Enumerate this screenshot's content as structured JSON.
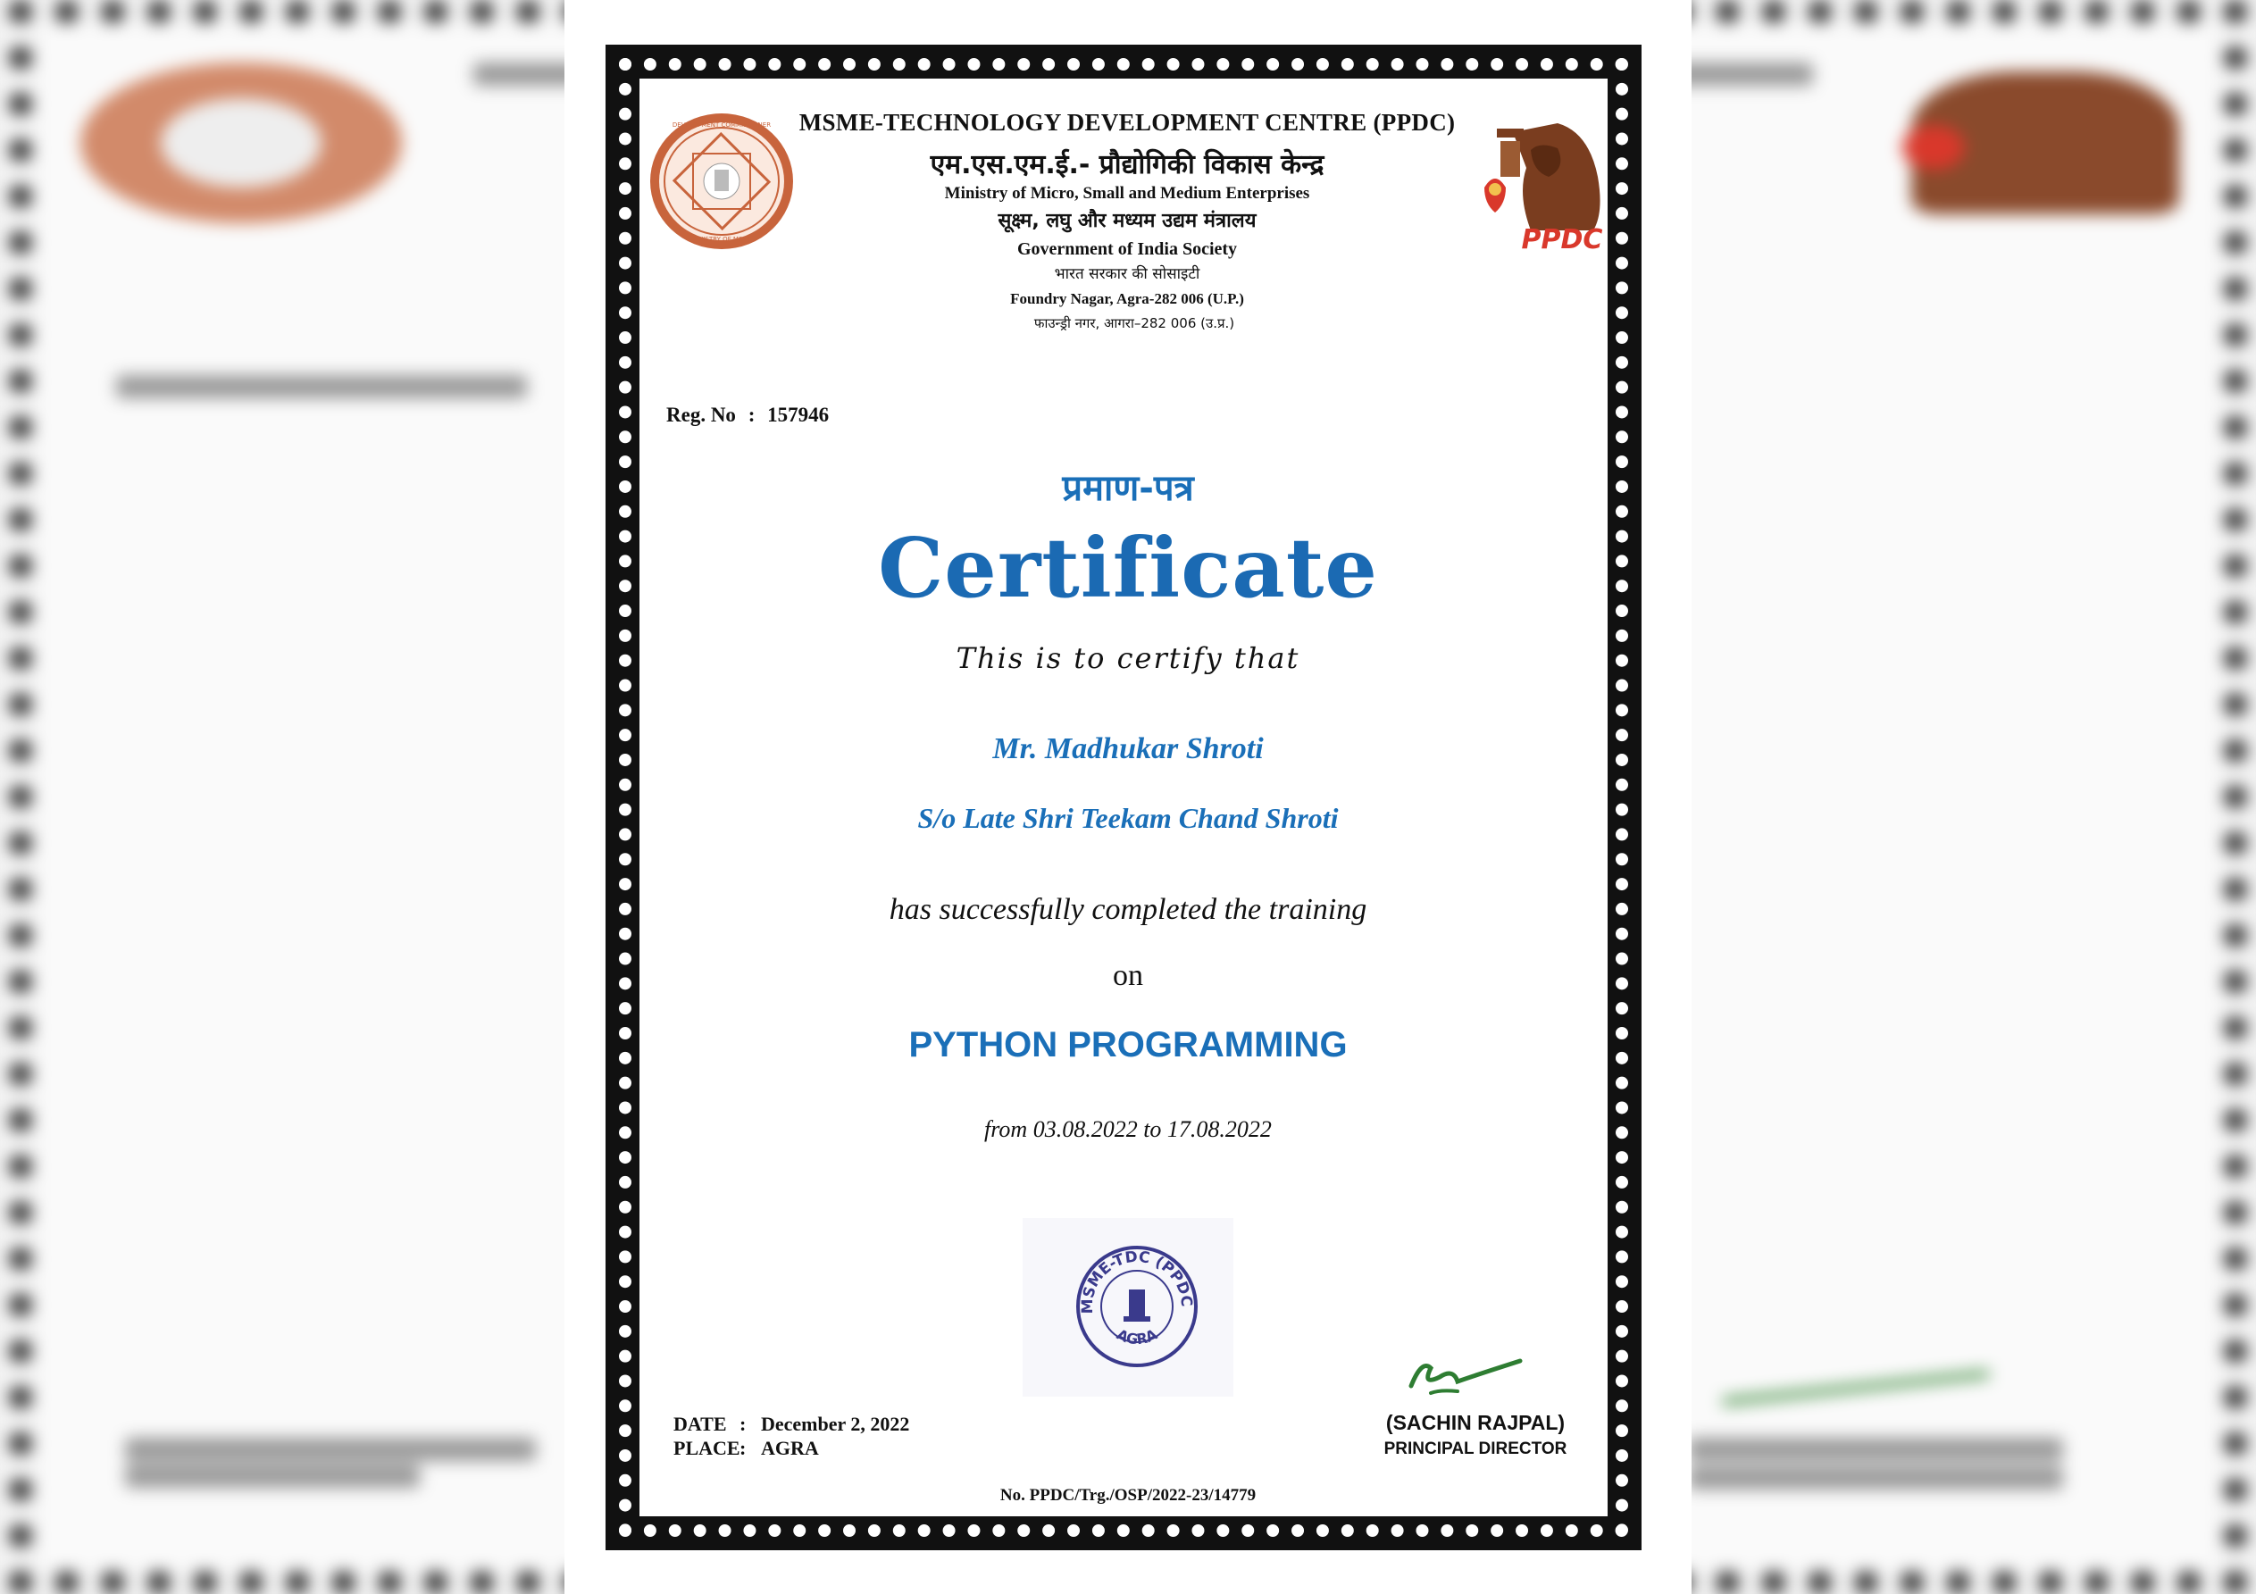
{
  "header": {
    "org_en": "MSME-TECHNOLOGY DEVELOPMENT CENTRE (PPDC)",
    "org_hi": "एम.एस.एम.ई.- प्रौद्योगिकी विकास केन्द्र",
    "ministry_en": "Ministry of Micro, Small and Medium Enterprises",
    "ministry_hi": "सूक्ष्म, लघु और मध्यम उद्यम मंत्रालय",
    "society_en": "Government of India Society",
    "society_hi": "भारत सरकार की सोसाइटी",
    "address_en": "Foundry Nagar, Agra-282 006 (U.P.)",
    "address_hi": "फाउन्ड्री नगर, आगरा–282 006 (उ.प्र.)",
    "logo_text": "PPDC",
    "left_seal_text_top": "DEVELOPMENT COMMISSIONER",
    "left_seal_text_bottom": "MINISTRY OF MSME"
  },
  "registration": {
    "label": "Reg. No",
    "separator": ":",
    "value": "157946"
  },
  "certificate": {
    "title_hi": "प्रमाण-पत्र",
    "title_en": "Certificate",
    "certify_line": "This is to certify that",
    "recipient_name": "Mr. Madhukar Shroti",
    "recipient_parent": "S/o Late Shri Teekam Chand Shroti",
    "completion_line": "has successfully completed the training",
    "on_word": "on",
    "course": "PYTHON PROGRAMMING",
    "period": "from 03.08.2022 to 17.08.2022"
  },
  "stamp": {
    "top_text": "MSME-TDC (PPDC)",
    "bottom_text": "AGRA"
  },
  "footer": {
    "date_label": "DATE",
    "date_value": "December 2, 2022",
    "place_label": "PLACE",
    "place_value": "AGRA",
    "separator": ":",
    "signatory_name": "(SACHIN RAJPAL)",
    "signatory_title": "PRINCIPAL DIRECTOR",
    "reference_no": "No. PPDC/Trg./OSP/2022-23/14779"
  },
  "colors": {
    "accent_blue": "#1a6fb8",
    "seal_orange": "#c8643c",
    "logo_brown": "#7a3d1f",
    "logo_red": "#d9382b",
    "stamp_purple": "#3a3a8c",
    "signature_green": "#2e7d32"
  }
}
